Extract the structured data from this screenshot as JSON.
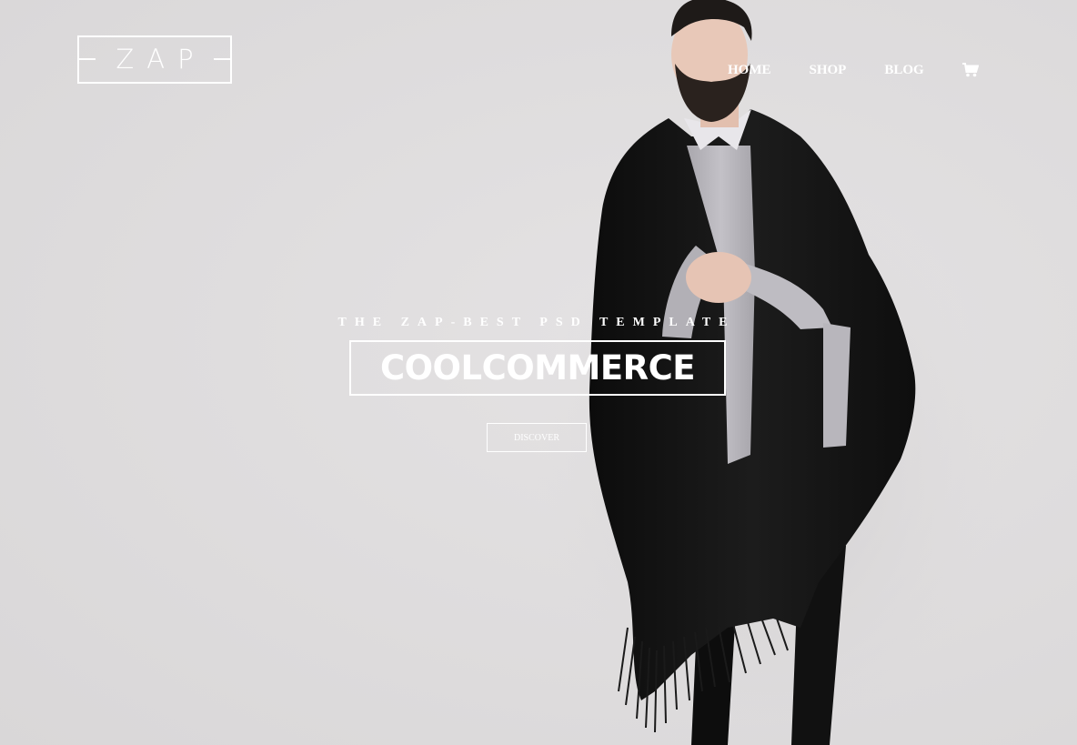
{
  "logo": {
    "text": "ZAP"
  },
  "nav": {
    "items": [
      {
        "label": "HOME"
      },
      {
        "label": "SHOP"
      },
      {
        "label": "BLOG"
      }
    ],
    "cart_icon": "shopping-cart-icon"
  },
  "hero": {
    "tagline": "THE ZAP-BEST PSD TEMPLATE",
    "headline": "COOLCOMMERCE",
    "cta_label": "DISCOVER"
  },
  "colors": {
    "background": "#e0dedf",
    "text": "#ffffff",
    "poncho": "#141414",
    "sweater": "#b9b7bd"
  }
}
